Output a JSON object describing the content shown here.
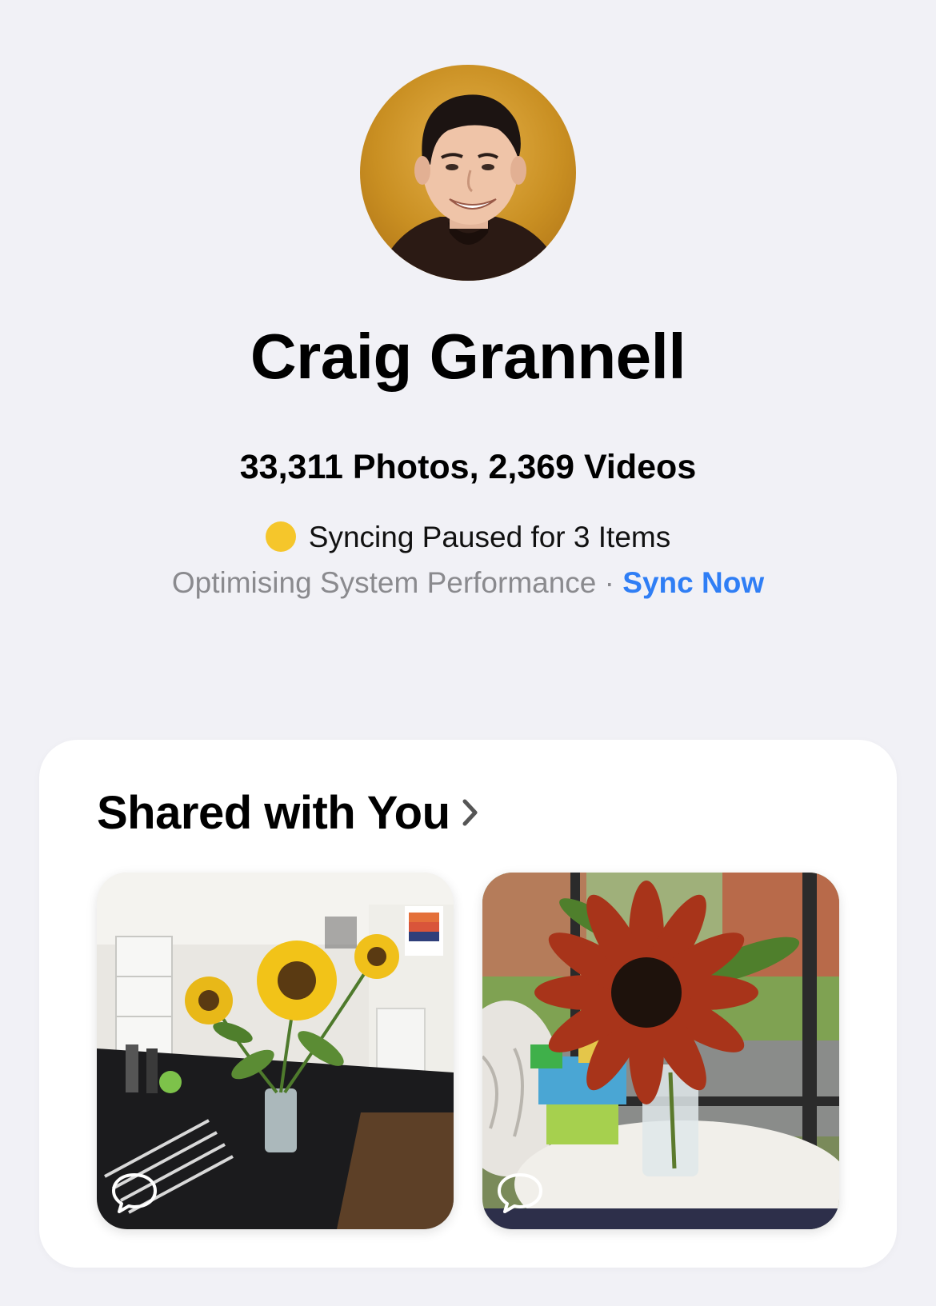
{
  "profile": {
    "name": "Craig Grannell",
    "counts": "33,311 Photos, 2,369 Videos"
  },
  "sync": {
    "status_text": "Syncing Paused for 3 Items",
    "status_color": "#f5c62b",
    "reason_text": "Optimising System Performance",
    "separator": "·",
    "action_label": "Sync Now",
    "action_color": "#2f7ef5"
  },
  "shared": {
    "title": "Shared with You",
    "chevron_icon": "chevron-right-icon",
    "items": [
      {
        "subject": "sunflowers-kitchen-photo",
        "icon": "comment-bubble-icon"
      },
      {
        "subject": "red-sunflower-photo",
        "icon": "comment-bubble-icon"
      }
    ]
  }
}
